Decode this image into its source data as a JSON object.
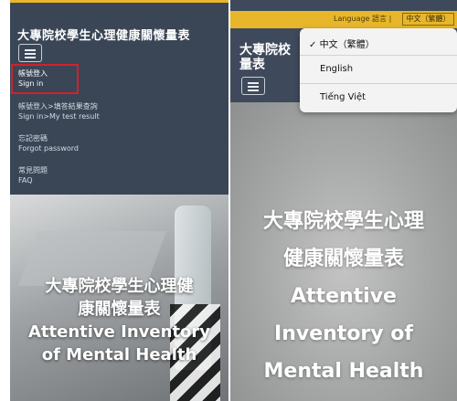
{
  "left_screen": {
    "title": "大專院校學生心理健康關懷量表",
    "menu": [
      {
        "zh": "帳號登入",
        "en": "Sign in"
      },
      {
        "zh": "帳號登入>填答結果查詢",
        "en": "Sign in>My test result"
      },
      {
        "zh": "忘記密碼",
        "en": "Forgot password"
      },
      {
        "zh": "常見問題",
        "en": "FAQ"
      }
    ],
    "hero": {
      "line1": "大專院校學生心理健",
      "line2": "康關懷量表",
      "line3": "Attentive Inventory",
      "line4": "of Mental Health"
    }
  },
  "right_screen": {
    "lang_label": "Language 語言 |",
    "lang_current": "中文（繁體）",
    "title_line1": "大專院校",
    "title_line2": "量表",
    "dropdown": [
      {
        "label": "中文（繁體）",
        "checkmark": "✓",
        "selected": true
      },
      {
        "label": "English"
      },
      {
        "label": "Tiếng Việt"
      }
    ],
    "hero": {
      "line1": "大專院校學生心理",
      "line2": "健康關懷量表",
      "line3": "Attentive",
      "line4": "Inventory of",
      "line5": "Mental Health"
    }
  },
  "colors": {
    "nav_bg": "#3a4656",
    "accent_yellow": "#e7b62a",
    "highlight_red": "#d3212c"
  }
}
